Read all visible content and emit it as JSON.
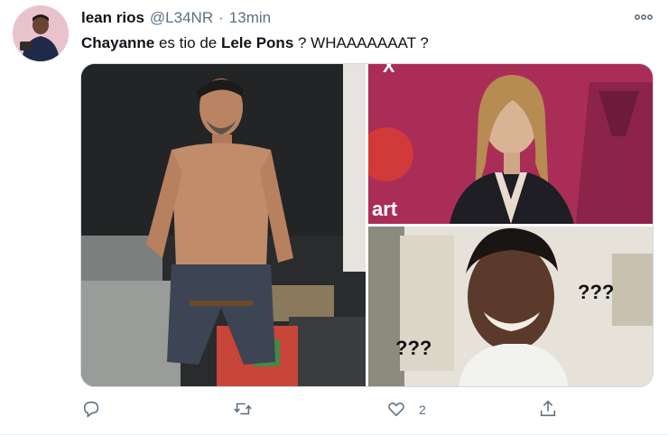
{
  "tweet": {
    "author_name": "lean rios",
    "author_handle": "@L34NR",
    "separator": "·",
    "time": "13min",
    "text_parts": [
      "Chayanne",
      " es tio de ",
      "Lele Pons",
      " ? WHAAAAAAAT ?"
    ],
    "media": {
      "tr_overlay_text": "art",
      "tr_overlay_mark": "X",
      "br_text_1": "???",
      "br_text_2": "???"
    },
    "actions": {
      "reply_count": "",
      "retweet_count": "",
      "like_count": "2",
      "share_label": ""
    }
  },
  "icons": [
    "more-icon",
    "reply-icon",
    "retweet-icon",
    "like-icon",
    "share-icon"
  ],
  "colors": {
    "text_secondary": "#5b7083",
    "border": "#cfd9de"
  }
}
